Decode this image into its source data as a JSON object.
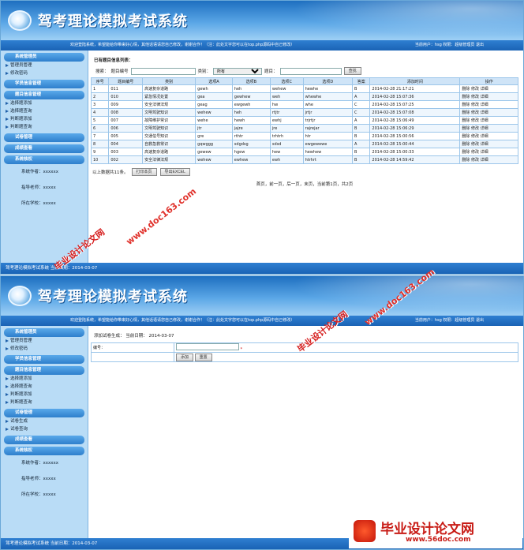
{
  "app": {
    "title": "驾考理论模拟考试系统"
  },
  "infobar": {
    "welcome": "欢迎登陆系统，希望能给你带来好心情，其他话语请您自己修改，谢谢合作！（注：此处文字您可以在top.php源码中自己修改）",
    "user": "当前用户：hsg 权限：超级管理员  退出"
  },
  "sidebar": {
    "sections": [
      "系统管理员",
      "学员信息管理",
      "题目信息管理",
      "试卷管理",
      "成绩查看",
      "系统核权"
    ],
    "admin_items": [
      "管理员管理",
      "修改密码"
    ],
    "question_items": [
      "选择题添加",
      "选择题查询",
      "判断题添加",
      "判断题查询"
    ],
    "exam_items": [
      "试卷生成",
      "试卷查询"
    ],
    "info": [
      "系统作者：xxxxxx",
      "指导老师：xxxxx",
      "所在学校：xxxxx"
    ]
  },
  "footer": {
    "s1": "驾考理论模拟考试系统 当前日期：2014-03-07",
    "s2": "驾考理论模拟考试系统 当前日期：2014-03-07"
  },
  "list": {
    "heading": "已有题目信息列表：",
    "search_label": "搜索：",
    "code_label": "题目编号",
    "type_label": "类别：",
    "type_selected": "所有",
    "title_label": "题目：",
    "search_button": "查找",
    "columns": [
      "序号",
      "题目编号",
      "类别",
      "选项A",
      "选项B",
      "选项C",
      "选项D",
      "答案",
      "添加时间",
      "操作"
    ],
    "rows": [
      [
        "1",
        "011",
        "高速复杂道路",
        "gewh",
        "heh",
        "wehew",
        "hewhe",
        "B",
        "2014-02-28 21:17:21"
      ],
      [
        "2",
        "010",
        "紧急情况处置",
        "gea",
        "gewhew",
        "weh",
        "whewhe",
        "A",
        "2014-02-28 15:07:36"
      ],
      [
        "3",
        "009",
        "安全法律法规",
        "geag",
        "ewgewh",
        "hw",
        "whe",
        "C",
        "2014-02-28 15:07:25"
      ],
      [
        "4",
        "008",
        "文明驾驶知识",
        "wehew",
        "heh",
        "rtjtr",
        "jrtjr",
        "C",
        "2014-02-28 15:07:08"
      ],
      [
        "5",
        "007",
        "故障维护常识",
        "wehe",
        "hewh",
        "ewhj",
        "trjrtjr",
        "A",
        "2014-02-28 15:06:49"
      ],
      [
        "6",
        "006",
        "文明驾驶知识",
        "jtr",
        "jajre",
        "jre",
        "rajrejar",
        "B",
        "2014-02-28 15:06:29"
      ],
      [
        "7",
        "005",
        "交通信号知识",
        "gre",
        "rthtr",
        "trhtrh",
        "htr",
        "B",
        "2014-02-28 15:00:56"
      ],
      [
        "8",
        "004",
        "自救急救常识",
        "gqwggg",
        "sdgdsg",
        "sdsd",
        "ewgewewe",
        "A",
        "2014-02-28 15:00:44"
      ],
      [
        "9",
        "003",
        "高速复杂道路",
        "gewew",
        "hgew",
        "hew",
        "hewhew",
        "B",
        "2014-02-28 15:00:33"
      ],
      [
        "10",
        "002",
        "安全法律法规",
        "wehew",
        "ewhew",
        "ewh",
        "htrhrt",
        "B",
        "2014-02-28 14:59:42"
      ]
    ],
    "actions": "删除 修改 详细",
    "total": "以上数据共11条。",
    "print_button": "打印本页",
    "export_button": "导出EXCEL",
    "pager": "首页，前一页，后一页，末页，当前第1页，共2页"
  },
  "form": {
    "heading": "添加试卷生成： 当前日期： 2014-03-07",
    "code_label": "编号：",
    "required": "*",
    "add_button": "添加",
    "reset_button": "重置"
  },
  "watermark": {
    "a": "毕业设计论文网",
    "b": "www.doc163.com"
  },
  "logo": {
    "cn": "毕业设计论文网",
    "url": "www.56doc.com"
  }
}
